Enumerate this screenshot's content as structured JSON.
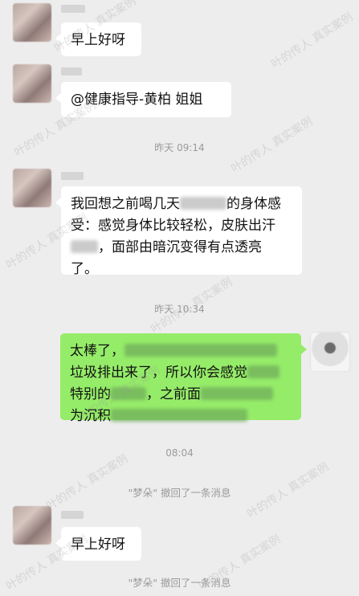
{
  "messages": [
    {
      "text": "早上好呀"
    },
    {
      "text": "@健康指导-黄柏  姐姐"
    },
    {
      "time": "昨天 09:14"
    },
    {
      "line1_a": "我回想之前喝几天",
      "line1_b": "的身体感",
      "line2": "受：感觉身体比较轻松，皮肤出汗",
      "line3_a": "，面部由暗沉变得有点透亮",
      "line4": "了。"
    },
    {
      "time": "昨天 10:34"
    },
    {
      "line1": "太棒了，",
      "line2": "垃圾排出来了，所以你会感觉",
      "line3_a": "特别的",
      "line3_b": "，之前面",
      "line4": "为沉积"
    },
    {
      "time": "08:04"
    },
    {
      "system": "\"梦朵\" 撤回了一条消息"
    },
    {
      "text": "早上好呀"
    },
    {
      "system": "\"梦朵\" 撤回了一条消息"
    }
  ],
  "watermark": "叶的传人  真实案例"
}
